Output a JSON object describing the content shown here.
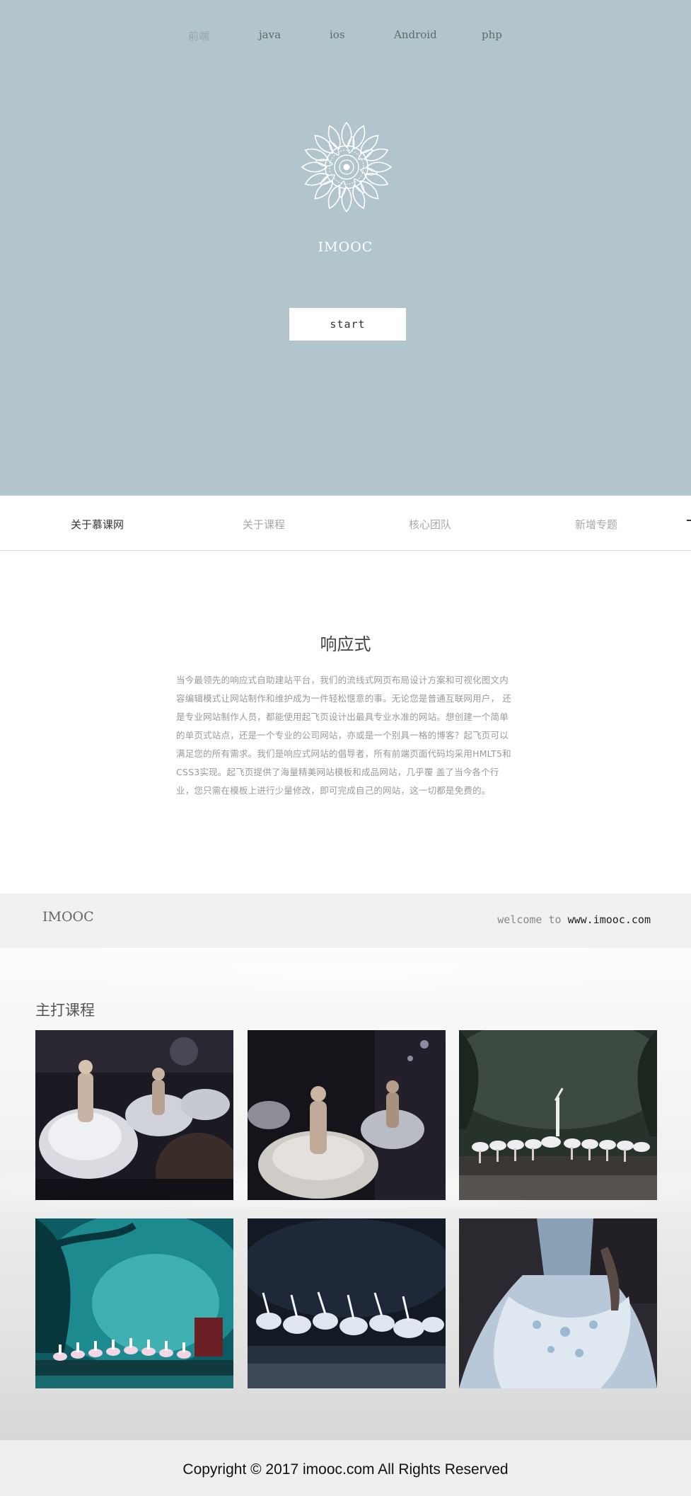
{
  "hero": {
    "nav": [
      {
        "label": "前端",
        "active": true
      },
      {
        "label": "java",
        "active": false
      },
      {
        "label": "ios",
        "active": false
      },
      {
        "label": "Android",
        "active": false
      },
      {
        "label": "php",
        "active": false
      }
    ],
    "logo_icon": "lace-mandala-icon",
    "title": "IMOOC",
    "start_label": "start",
    "background_color": "#b3c5cc"
  },
  "tabs": {
    "items": [
      {
        "label": "关于慕课网",
        "active": true
      },
      {
        "label": "关于课程",
        "active": false
      },
      {
        "label": "核心团队",
        "active": false
      },
      {
        "label": "新增专题",
        "active": false
      }
    ]
  },
  "intro": {
    "title": "响应式",
    "text": "当今最领先的响应式自助建站平台，我们的流线式网页布局设计方案和可视化图文内容编辑模式让网站制作和维护成为一件轻松惬意的事。无论您是普通互联网用户， 还是专业网站制作人员，都能使用起飞页设计出最具专业水准的网站。想创建一个简单的单页式站点，还是一个专业的公司网站，亦或是一个别具一格的博客？起飞页可以满足您的所有需求。我们是响应式网站的倡导者，所有前端页面代码均采用HMLT5和CSS3实现。起飞页提供了海量精美网站模板和成品网站，几乎覆 盖了当今各个行业，您只需在模板上进行少量修改，即可完成自己的网站，这一切都是免费的。"
  },
  "strip": {
    "brand": "IMOOC",
    "welcome_prefix": "welcome to ",
    "welcome_url": "www.imooc.com"
  },
  "courses": {
    "title": "主打课程",
    "images": [
      {
        "name": "ballet-backstage-photo-1"
      },
      {
        "name": "ballet-backstage-photo-2"
      },
      {
        "name": "swan-lake-stage-photo"
      },
      {
        "name": "ballet-teal-forest-stage-photo"
      },
      {
        "name": "ballet-corps-dark-photo"
      },
      {
        "name": "ballerina-tutu-closeup-photo"
      }
    ]
  },
  "footer": {
    "copyright": "Copyright © 2017 imooc.com All Rights Reserved"
  }
}
